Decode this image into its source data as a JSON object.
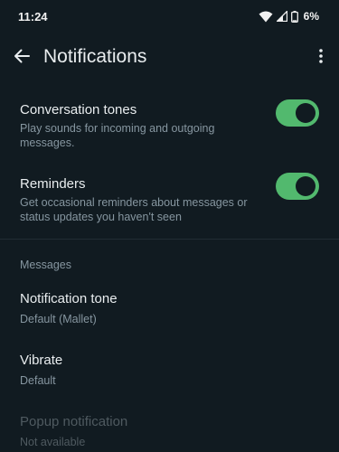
{
  "status_bar": {
    "time": "11:24",
    "battery": "6%",
    "icons": [
      "wifi-icon",
      "cell-signal-icon",
      "battery-icon"
    ]
  },
  "header": {
    "title": "Notifications",
    "back_icon": "arrow-left-icon",
    "menu_icon": "more-vert-icon"
  },
  "settings": [
    {
      "title": "Conversation tones",
      "subtitle": "Play sounds for incoming and outgoing messages.",
      "enabled": true
    },
    {
      "title": "Reminders",
      "subtitle": "Get occasional reminders about messages or status updates you haven't seen",
      "enabled": true
    }
  ],
  "messages_section": {
    "header": "Messages",
    "items": [
      {
        "title": "Notification tone",
        "value": "Default (Mallet)",
        "disabled": false
      },
      {
        "title": "Vibrate",
        "value": "Default",
        "disabled": false
      },
      {
        "title": "Popup notification",
        "value": "Not available",
        "disabled": true
      }
    ]
  },
  "colors": {
    "background": "#111b21",
    "toggle_on": "#52b96e",
    "primary_text": "#e9edef",
    "secondary_text": "#8696a0",
    "disabled_text": "#4f5a60"
  }
}
